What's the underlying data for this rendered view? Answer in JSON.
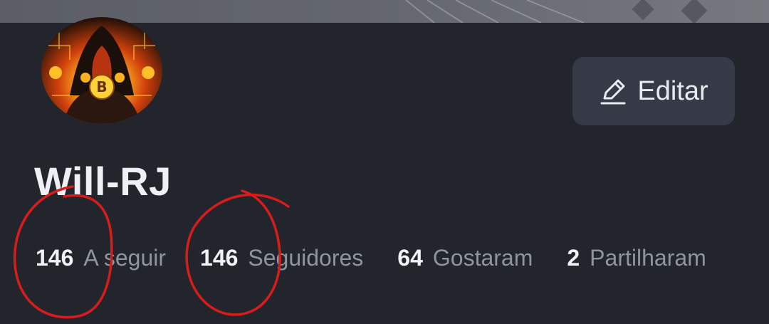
{
  "profile": {
    "username": "Will-RJ",
    "edit_label": "Editar"
  },
  "stats": [
    {
      "value": "146",
      "label": "A seguir"
    },
    {
      "value": "146",
      "label": "Seguidores"
    },
    {
      "value": "64",
      "label": "Gostaram"
    },
    {
      "value": "2",
      "label": "Partilharam"
    }
  ],
  "icons": {
    "edit": "pencil-edit-icon"
  },
  "colors": {
    "background": "#22252c",
    "button": "#353a46",
    "annotation": "#d81c1c"
  }
}
